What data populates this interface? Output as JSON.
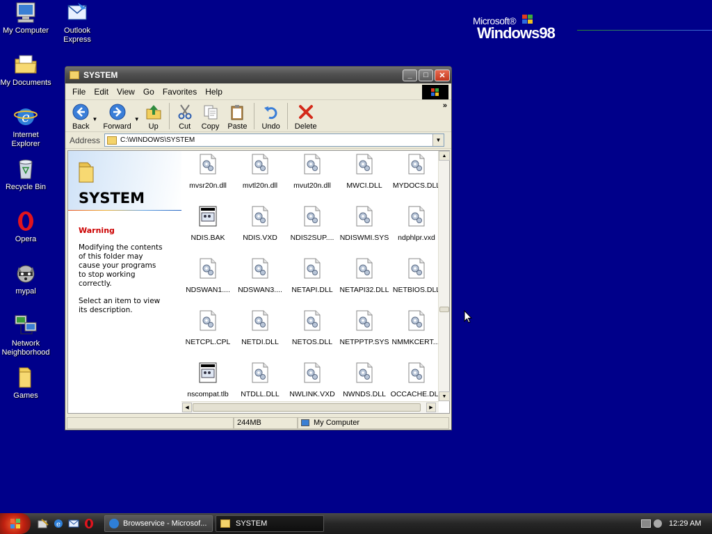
{
  "desktop": {
    "icons": [
      {
        "label1": "My Computer",
        "label2": ""
      },
      {
        "label1": "Outlook",
        "label2": "Express"
      },
      {
        "label1": "My Documents",
        "label2": ""
      },
      {
        "label1": "Internet",
        "label2": "Explorer"
      },
      {
        "label1": "Recycle Bin",
        "label2": ""
      },
      {
        "label1": "Opera",
        "label2": ""
      },
      {
        "label1": "mypal",
        "label2": ""
      },
      {
        "label1": "Network",
        "label2": "Neighborhood"
      },
      {
        "label1": "Games",
        "label2": ""
      }
    ],
    "logo": {
      "microsoft": "Microsoft®",
      "windows": "Windows98"
    }
  },
  "window": {
    "title": "SYSTEM",
    "menu": [
      "File",
      "Edit",
      "View",
      "Go",
      "Favorites",
      "Help"
    ],
    "toolbar": {
      "back": "Back",
      "forward": "Forward",
      "up": "Up",
      "cut": "Cut",
      "copy": "Copy",
      "paste": "Paste",
      "undo": "Undo",
      "delete": "Delete"
    },
    "address": {
      "label": "Address",
      "value": "C:\\WINDOWS\\SYSTEM"
    },
    "left_pane": {
      "title": "SYSTEM",
      "warning": "Warning",
      "p1_l1": "Modifying the contents",
      "p1_l2": "of this folder may",
      "p1_l3": "cause your programs",
      "p1_l4": "to stop working",
      "p1_l5": "correctly.",
      "p2_l1": "Select an item to view",
      "p2_l2": "its description."
    },
    "files": [
      [
        "mvsr20n.dll",
        "mvtl20n.dll",
        "mvut20n.dll",
        "MWCI.DLL",
        "MYDOCS.DLL"
      ],
      [
        "NDIS.BAK",
        "NDIS.VXD",
        "NDIS2SUP....",
        "NDISWMI.SYS",
        "ndphlpr.vxd"
      ],
      [
        "NDSWAN1....",
        "NDSWAN3....",
        "NETAPI.DLL",
        "NETAPI32.DLL",
        "NETBIOS.DLL"
      ],
      [
        "NETCPL.CPL",
        "NETDI.DLL",
        "NETOS.DLL",
        "NETPPTP.SYS",
        "NMMKCERT...."
      ],
      [
        "nscompat.tlb",
        "NTDLL.DLL",
        "NWLINK.VXD",
        "NWNDS.DLL",
        "OCCACHE.DLL"
      ]
    ],
    "status": {
      "size": "244MB",
      "zone": "My Computer"
    }
  },
  "taskbar": {
    "tasks": [
      {
        "label": "Browservice - Microsof..."
      },
      {
        "label": "SYSTEM"
      }
    ],
    "clock": "12:29 AM"
  }
}
